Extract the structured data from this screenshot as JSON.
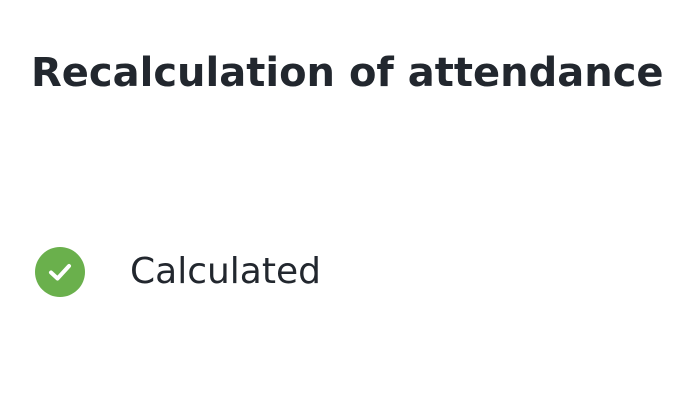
{
  "header": {
    "title": "Recalculation of attendance"
  },
  "status": {
    "icon": "check-circle-icon",
    "icon_color": "#6ab04c",
    "label": "Calculated"
  }
}
